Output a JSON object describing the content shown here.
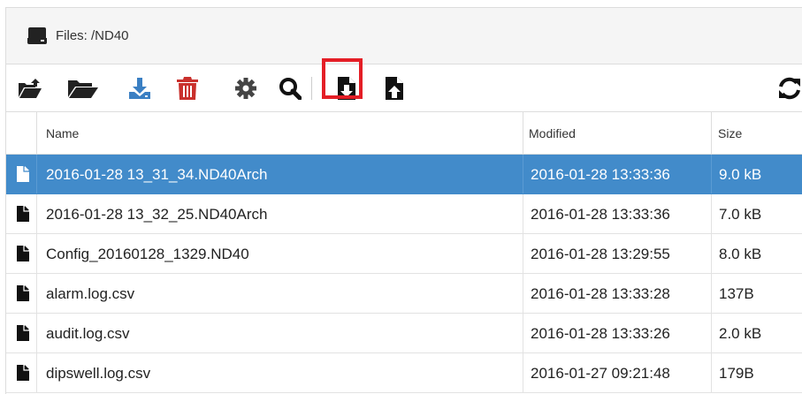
{
  "header": {
    "title": "Files: /ND40",
    "icon": "hdd-icon"
  },
  "toolbar": {
    "buttons": [
      {
        "name": "upload-folder-icon"
      },
      {
        "name": "open-folder-icon"
      },
      {
        "name": "download-icon"
      },
      {
        "name": "delete-icon"
      },
      {
        "name": "settings-gear-icon"
      },
      {
        "name": "search-icon"
      },
      {
        "name": "file-download-icon",
        "highlighted": true
      },
      {
        "name": "file-upload-icon"
      },
      {
        "name": "refresh-icon"
      }
    ],
    "highlight_color": "#e41e26"
  },
  "table": {
    "columns": {
      "name": "Name",
      "modified": "Modified",
      "size": "Size"
    },
    "rows": [
      {
        "name": "2016-01-28 13_31_34.ND40Arch",
        "modified": "2016-01-28 13:33:36",
        "size": "9.0 kB"
      },
      {
        "name": "2016-01-28 13_32_25.ND40Arch",
        "modified": "2016-01-28 13:33:36",
        "size": "7.0 kB"
      },
      {
        "name": "Config_20160128_1329.ND40",
        "modified": "2016-01-28 13:29:55",
        "size": "8.0 kB"
      },
      {
        "name": "alarm.log.csv",
        "modified": "2016-01-28 13:33:28",
        "size": "137B"
      },
      {
        "name": "audit.log.csv",
        "modified": "2016-01-28 13:33:26",
        "size": "2.0 kB"
      },
      {
        "name": "dipswell.log.csv",
        "modified": "2016-01-27 09:21:48",
        "size": "179B"
      }
    ],
    "selected_row": 0,
    "selected_color": "#428bca"
  },
  "colors": {
    "accent_blue": "#3a7fc3",
    "delete_red": "#c9302c",
    "icon_dark": "#222222"
  }
}
